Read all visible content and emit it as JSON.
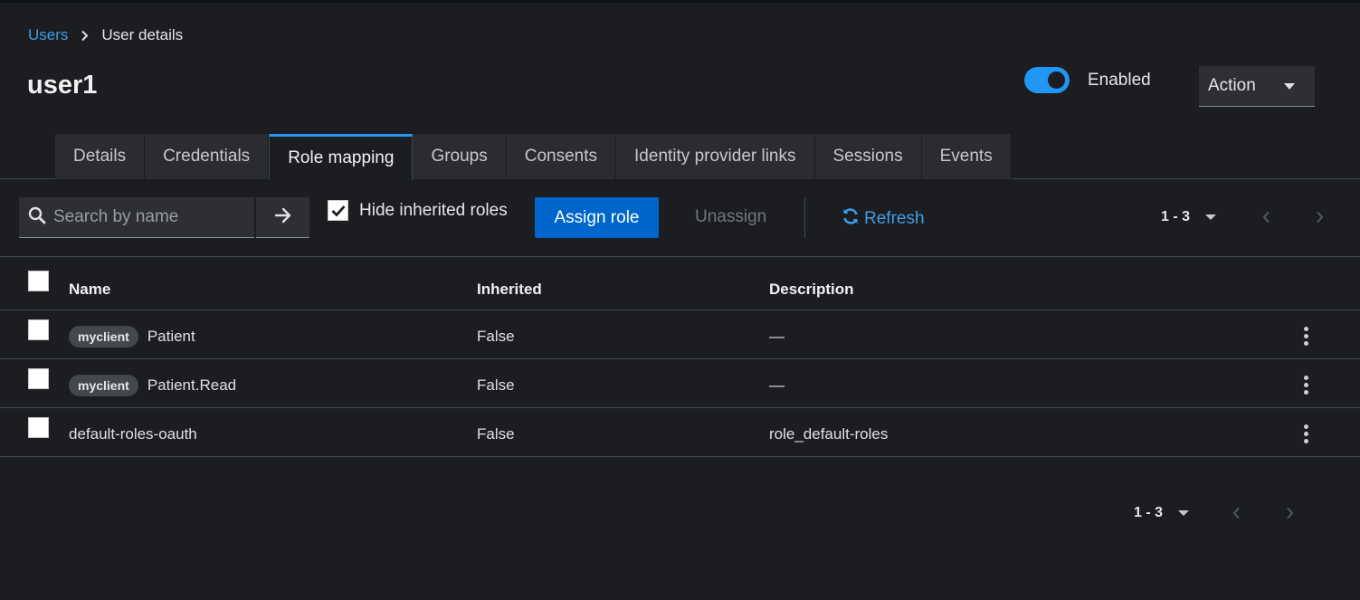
{
  "breadcrumb": {
    "parent": "Users",
    "current": "User details"
  },
  "page_title": "user1",
  "enabled_toggle": {
    "label": "Enabled",
    "on": true,
    "color": "#2196f3"
  },
  "action_menu": {
    "label": "Action"
  },
  "tabs": [
    {
      "label": "Details",
      "active": false
    },
    {
      "label": "Credentials",
      "active": false
    },
    {
      "label": "Role mapping",
      "active": true
    },
    {
      "label": "Groups",
      "active": false
    },
    {
      "label": "Consents",
      "active": false
    },
    {
      "label": "Identity provider links",
      "active": false
    },
    {
      "label": "Sessions",
      "active": false
    },
    {
      "label": "Events",
      "active": false
    }
  ],
  "toolbar": {
    "search_placeholder": "Search by name",
    "hide_inherited_label": "Hide inherited roles",
    "hide_inherited_checked": true,
    "assign_label": "Assign role",
    "unassign_label": "Unassign",
    "refresh_label": "Refresh",
    "pagination": "1 - 3"
  },
  "table": {
    "columns": [
      "Name",
      "Inherited",
      "Description"
    ],
    "rows": [
      {
        "badge": "myclient",
        "name": "Patient",
        "inherited": "False",
        "description": "—"
      },
      {
        "badge": "myclient",
        "name": "Patient.Read",
        "inherited": "False",
        "description": "—"
      },
      {
        "badge": "",
        "name": "default-roles-oauth",
        "inherited": "False",
        "description": "role_default-roles"
      }
    ]
  },
  "bottom_pagination": "1 - 3",
  "colors": {
    "accent": "#0066cc",
    "link": "#3d9ee8",
    "background": "#1b1d21"
  }
}
